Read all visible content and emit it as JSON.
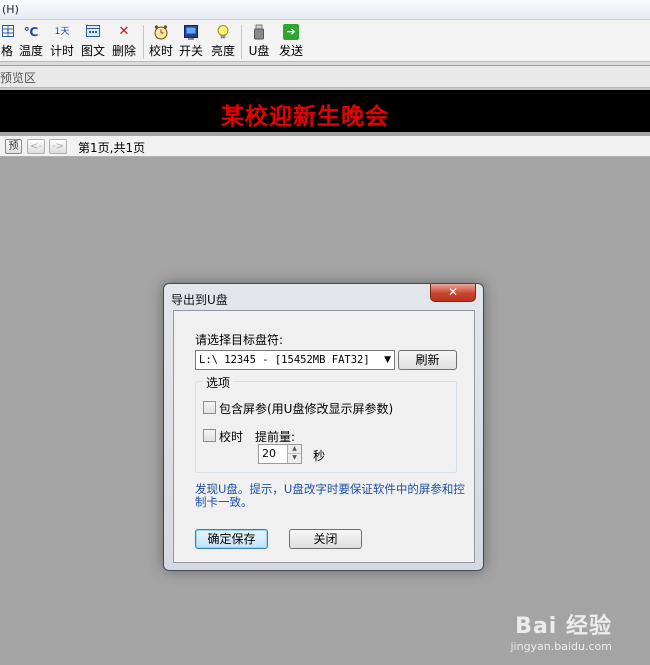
{
  "menu": {
    "help": "(H)"
  },
  "toolbar": {
    "items": [
      {
        "label": "格",
        "icon": "table-icon"
      },
      {
        "label": "温度",
        "icon": "temperature-icon",
        "glyph": "℃"
      },
      {
        "label": "计时",
        "icon": "timer-icon",
        "glyph": "1天"
      },
      {
        "label": "图文",
        "icon": "image-text-icon"
      },
      {
        "label": "删除",
        "icon": "delete-icon",
        "glyph": "✕"
      },
      {
        "label": "校时",
        "icon": "clock-sync-icon"
      },
      {
        "label": "开关",
        "icon": "power-switch-icon"
      },
      {
        "label": "亮度",
        "icon": "brightness-bulb-icon"
      },
      {
        "label": "U盘",
        "icon": "usb-drive-icon"
      },
      {
        "label": "发送",
        "icon": "send-arrow-icon",
        "glyph": "➔"
      }
    ]
  },
  "preview": {
    "header": "预览区",
    "banner_text": "某校迎新生晚会",
    "banner_color": "#e60000"
  },
  "pager": {
    "prefix_label": "预",
    "prev_label": "<-",
    "next_label": "->",
    "page_info": "第1页,共1页"
  },
  "dialog": {
    "title": "导出到U盘",
    "close_glyph": "✕",
    "target_label": "请选择目标盘符:",
    "drive_value": "L:\\ 12345 - [15452MB FAT32]",
    "refresh_label": "刷新",
    "options_title": "选项",
    "include_params_label": "包含屏参(用U盘修改显示屏参数)",
    "include_params_checked": false,
    "sync_time_label": "校时",
    "sync_time_checked": false,
    "advance_label": "提前量:",
    "advance_value": "20",
    "advance_unit": "秒",
    "info_text": "发现U盘。提示，U盘改字时要保证软件中的屏参和控制卡一致。",
    "ok_label": "确定保存",
    "close_label": "关闭"
  },
  "watermark": {
    "brand": "Bai 经验",
    "url": "jingyan.baidu.com"
  },
  "colors": {
    "link_blue": "#1e4fa8",
    "canvas_gray": "#a4a4a4"
  }
}
